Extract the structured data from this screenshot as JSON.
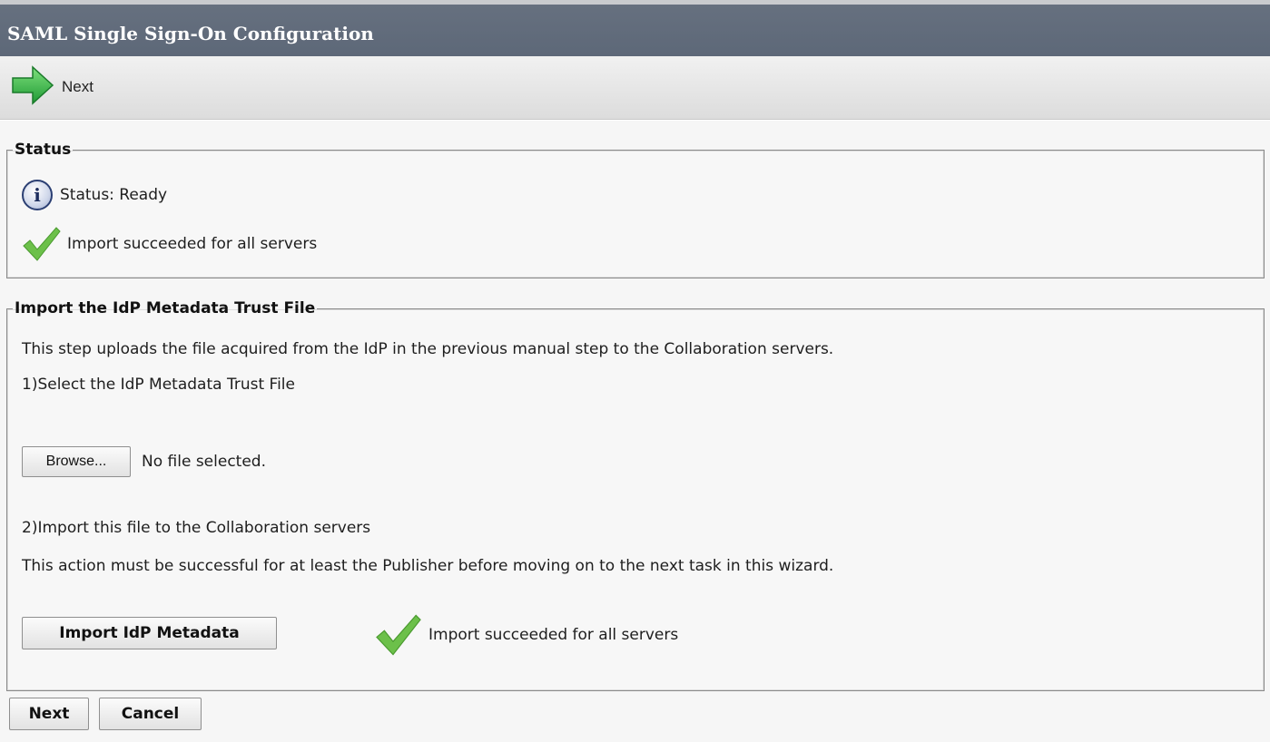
{
  "window": {
    "title": "SAML Single Sign-On Configuration"
  },
  "toolbar": {
    "next_label": "Next",
    "next_icon": "green-arrow-right-icon"
  },
  "status_section": {
    "legend": "Status",
    "status_text": "Status: Ready",
    "status_icon": "info-icon",
    "result_text": "Import succeeded for all servers",
    "result_icon": "checkmark-icon"
  },
  "import_section": {
    "legend": "Import the IdP Metadata Trust File",
    "description": "This step uploads the file acquired from the IdP in the previous manual step to the Collaboration servers.",
    "step1_label": "1)Select the IdP Metadata Trust File",
    "browse_label": "Browse...",
    "file_status": "No file selected.",
    "step2_label": "2)Import this file to the Collaboration servers",
    "step2_note": "This action must be successful for at least the Publisher before moving on to the next task in this wizard.",
    "import_button_label": "Import IdP Metadata",
    "import_result_text": "Import succeeded for all servers",
    "import_result_icon": "checkmark-icon"
  },
  "footer": {
    "next_label": "Next",
    "cancel_label": "Cancel"
  },
  "colors": {
    "titlebar": "#5d6878",
    "checkmark": "#6cc04a",
    "arrow": "#3fb54a"
  }
}
